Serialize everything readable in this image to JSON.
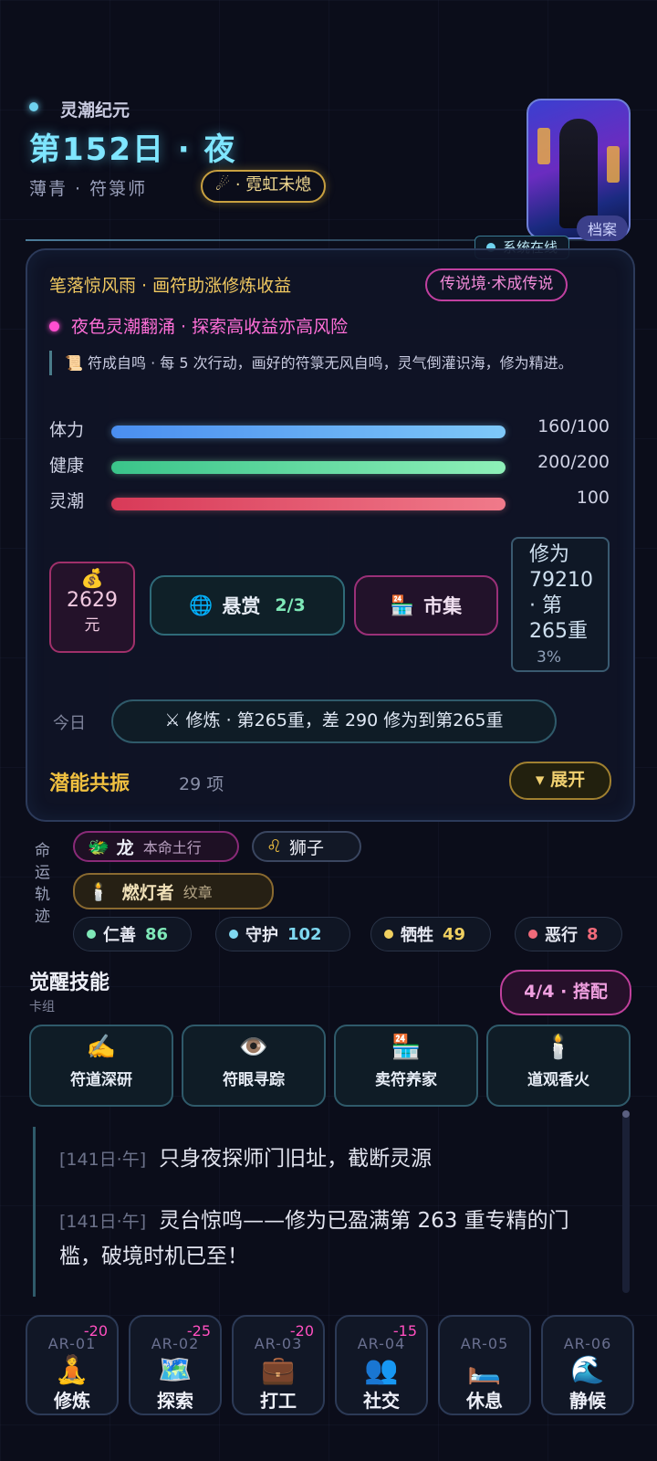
{
  "header": {
    "era": "灵潮纪元",
    "day_title": "第152日 · 夜",
    "character_line": "薄青 · 符箓师",
    "title_badge": "☄ · 霓虹未熄",
    "archive_tag": "档案",
    "system_status": "系统在线"
  },
  "panel": {
    "buff_primary": "笔落惊风雨 · 画符助涨修炼收益",
    "realm_badge": "传说境·术成传说",
    "buff_secondary": "夜色灵潮翻涌 · 探索高收益亦高风险",
    "quote": "📜 符成自鸣 · 每 5 次行动，画好的符箓无风自鸣，灵气倒灌识海，修为精进。",
    "stats": [
      {
        "label": "体力",
        "value": "160/100",
        "fill": 1.0,
        "color_from": "#4a8ef0",
        "color_to": "#7ec8f8"
      },
      {
        "label": "健康",
        "value": "200/200",
        "fill": 1.0,
        "color_from": "#3ac48a",
        "color_to": "#8ef0b8"
      },
      {
        "label": "灵潮",
        "value": "100",
        "fill": 1.0,
        "color_from": "#d83a58",
        "color_to": "#f07a8a"
      }
    ],
    "money_icon": "💰",
    "money_value": "2629",
    "money_unit": "元",
    "bounty_icon": "🌐",
    "bounty_label": "悬赏",
    "bounty_count": "2/3",
    "market_icon": "🏪",
    "market_label": "市集",
    "cultivation_lines": [
      "修为",
      "79210",
      "· 第",
      "265重"
    ],
    "cultivation_pct": "3%",
    "today_label": "今日",
    "today_text": "⚔ 修炼 · 第265重，差 290 修为到第265重",
    "potential_title": "潜能共振",
    "potential_count": "29 项",
    "expand_label": "▾ 展开"
  },
  "fate": {
    "label_chars": [
      "命",
      "运",
      "轨",
      "迹"
    ],
    "zodiac_icon": "🐲",
    "zodiac_name": "龙",
    "zodiac_sub": "本命土行",
    "sign_icon": "♌",
    "sign_name": "狮子",
    "medal_icon": "🕯️",
    "medal_name": "燃灯者",
    "medal_sub": "纹章",
    "virtues": [
      {
        "name": "仁善",
        "value": "86",
        "color": "#7fe8b8"
      },
      {
        "name": "守护",
        "value": "102",
        "color": "#7fd8f0"
      },
      {
        "name": "牺牲",
        "value": "49",
        "color": "#f0d060"
      },
      {
        "name": "恶行",
        "value": "8",
        "color": "#f06a7a"
      }
    ]
  },
  "skills": {
    "title": "觉醒技能",
    "subtitle": "卡组",
    "deck_label": "4/4 · 搭配",
    "cards": [
      {
        "icon": "✍️",
        "name": "符道深研"
      },
      {
        "icon": "👁️",
        "name": "符眼寻踪"
      },
      {
        "icon": "🏪",
        "name": "卖符养家"
      },
      {
        "icon": "🕯️",
        "name": "道观香火"
      }
    ]
  },
  "log": [
    {
      "time": "[141日·午]",
      "text": "只身夜探师门旧址，截断灵源"
    },
    {
      "time": "[141日·午]",
      "text": "灵台惊鸣——修为已盈满第 263 重专精的门槛，破境时机已至！"
    }
  ],
  "actions": [
    {
      "code": "AR-01",
      "icon": "🧘",
      "name": "修炼",
      "cost": "-20"
    },
    {
      "code": "AR-02",
      "icon": "🗺️",
      "name": "探索",
      "cost": "-25"
    },
    {
      "code": "AR-03",
      "icon": "💼",
      "name": "打工",
      "cost": "-20"
    },
    {
      "code": "AR-04",
      "icon": "👥",
      "name": "社交",
      "cost": "-15"
    },
    {
      "code": "AR-05",
      "icon": "🛏️",
      "name": "休息",
      "cost": ""
    },
    {
      "code": "AR-06",
      "icon": "🌊",
      "name": "静候",
      "cost": ""
    }
  ]
}
